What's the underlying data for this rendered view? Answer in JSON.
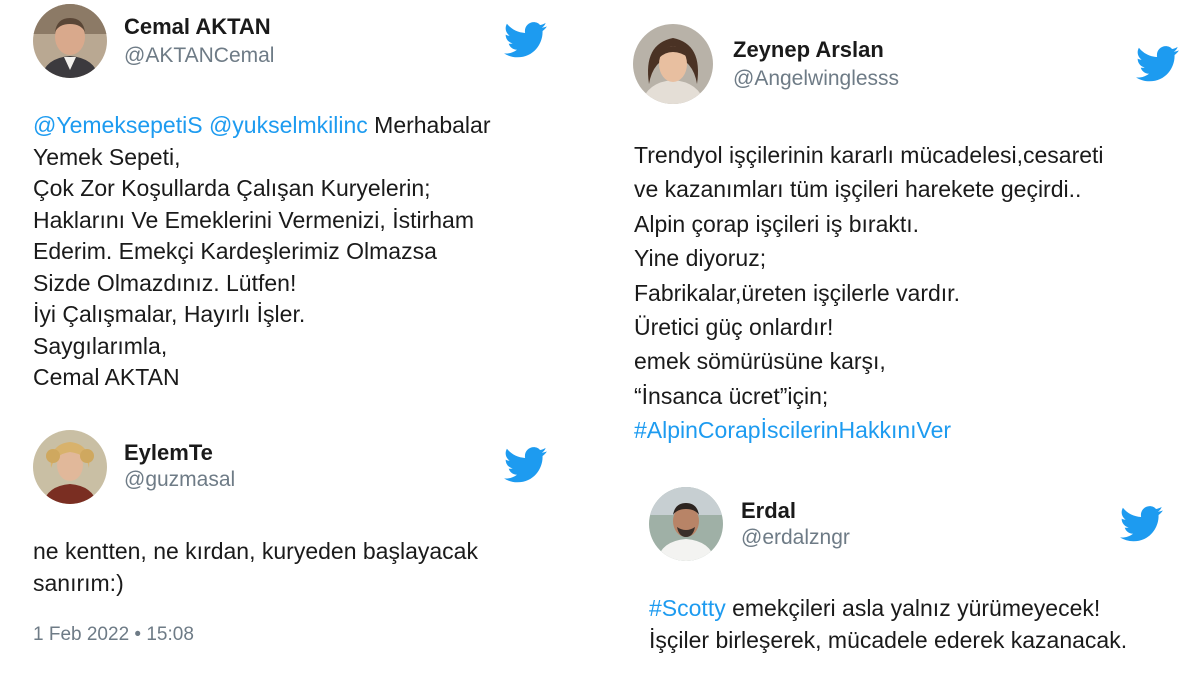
{
  "colors": {
    "link": "#1d9bf0",
    "twitter_bird": "#1d9bf0",
    "handle": "#6e7b86",
    "text": "#1a1a1a"
  },
  "icons": {
    "bird": "twitter-bird-icon"
  },
  "tweets": [
    {
      "name": "Cemal AKTAN",
      "handle": "@AKTANCemal",
      "mentions": [
        "@YemeksepetiS",
        "@yukselmkilinc"
      ],
      "lines": [
        "Merhabalar",
        "Yemek Sepeti,",
        "Çok Zor Koşullarda Çalışan Kuryelerin;",
        "Haklarını Ve Emeklerini Vermenizi, İstirham",
        "Ederim. Emekçi Kardeşlerimiz Olmazsa",
        "Sizde Olmazdınız. Lütfen!",
        "İyi Çalışmalar, Hayırlı İşler.",
        "Saygılarımla,",
        "Cemal AKTAN"
      ]
    },
    {
      "name": "EylemTe",
      "handle": "@guzmasal",
      "lines": [
        "ne kentten, ne kırdan, kuryeden başlayacak",
        "sanırım:)"
      ],
      "timestamp": "1 Feb 2022 • 15:08"
    },
    {
      "name": "Zeynep Arslan",
      "handle": "@Angelwinglesss",
      "lines": [
        "Trendyol işçilerinin kararlı mücadelesi,cesareti",
        "ve kazanımları tüm işçileri harekete geçirdi..",
        "Alpin çorap işçileri iş bıraktı.",
        "Yine diyoruz;",
        "Fabrikalar,üreten işçilerle vardır.",
        "Üretici güç onlardır!",
        "emek sömürüsüne karşı,",
        "“İnsanca ücret”için;"
      ],
      "hashtag": "#AlpinCorapİscilerinHakkınıVer"
    },
    {
      "name": "Erdal",
      "handle": "@erdalzngr",
      "hashtag": "#Scotty",
      "lines": [
        "emekçileri asla yalnız yürümeyecek!",
        "İşçiler birleşerek, mücadele ederek kazanacak."
      ]
    }
  ]
}
